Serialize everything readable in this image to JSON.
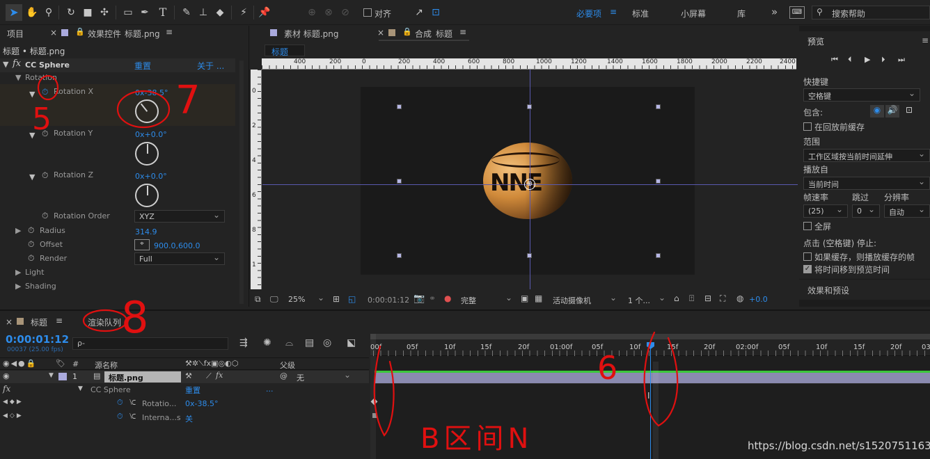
{
  "toolbar": {
    "align_label": "对齐",
    "workspaces": [
      "必要项",
      "标准",
      "小屏幕",
      "库"
    ],
    "more": "»",
    "search_placeholder": "搜索帮助"
  },
  "left_panel": {
    "tab_project": "项目",
    "tab_effect_controls_prefix": "效果控件",
    "tab_effect_controls_layer": "标题.png",
    "breadcrumb": "标题 • 标题.png",
    "effect_name": "CC Sphere",
    "reset_label": "重置",
    "about_label": "关于 ...",
    "group_rotation": "Rotation",
    "rotation_x_label": "Rotation X",
    "rotation_x_value": "0x-38.5°",
    "rotation_y_label": "Rotation Y",
    "rotation_y_value": "0x+0.0°",
    "rotation_z_label": "Rotation Z",
    "rotation_z_value": "0x+0.0°",
    "rotation_order_label": "Rotation Order",
    "rotation_order_value": "XYZ",
    "radius_label": "Radius",
    "radius_value": "314.9",
    "offset_label": "Offset",
    "offset_value": "900.0,600.0",
    "render_label": "Render",
    "render_value": "Full",
    "light_label": "Light",
    "shading_label": "Shading"
  },
  "viewer": {
    "tab_footage": "素材 标题.png",
    "tab_composition_prefix": "合成",
    "tab_composition_name": "标题",
    "comp_chip": "标题",
    "ruler_labels": [
      "400",
      "200",
      "0",
      "200",
      "400",
      "600",
      "800",
      "1000",
      "1200",
      "1400",
      "1600",
      "1800",
      "2000",
      "2200",
      "2400"
    ],
    "vruler_labels": [
      "0",
      "2",
      "4",
      "6",
      "8",
      "1"
    ],
    "zoom": "25%",
    "timecode": "0:00:01:12",
    "quality": "完整",
    "camera": "活动摄像机",
    "views": "1 个...",
    "exposure": "+0.0"
  },
  "right_panel": {
    "preview_title": "预览",
    "shortcut_label": "快捷键",
    "shortcut_value": "空格键",
    "include_label": "包含:",
    "cache_before_label": "在回放前缓存",
    "range_label": "范围",
    "range_value": "工作区域按当前时间延伸",
    "play_from_label": "播放自",
    "play_from_value": "当前时间",
    "frame_rate_label": "帧速率",
    "skip_label": "跳过",
    "resolution_label": "分辨率",
    "frame_rate_value": "(25)",
    "skip_value": "0",
    "resolution_value": "自动",
    "fullscreen_label": "全屏",
    "stop_label": "点击 (空格键) 停止:",
    "cached_label": "如果缓存，则播放缓存的帧",
    "move_time_label": "将时间移到预览时间",
    "effects_presets": "效果和预设"
  },
  "timeline": {
    "tab_comp": "标题",
    "tab_render_queue": "渲染队列",
    "timecode": "0:00:01:12",
    "frame_info": "00037 (25.00 fps)",
    "search_placeholder": "ρ-",
    "col_index": "#",
    "col_source": "源名称",
    "col_parent": "父级",
    "layer_index": "1",
    "layer_name": "标题.png",
    "layer_parent": "无",
    "fx_label": "fx",
    "effect_name": "CC Sphere",
    "effect_reset": "重置",
    "effect_dots": "...",
    "prop1_label": "Rotatio...",
    "prop1_value": "0x-38.5°",
    "prop2_label": "Interna...s",
    "prop2_value": "关",
    "ruler_labels": [
      "00f",
      "05f",
      "10f",
      "15f",
      "20f",
      "01:00f",
      "05f",
      "10f",
      "15f",
      "20f",
      "02:00f",
      "05f",
      "10f",
      "15f",
      "20f",
      "03"
    ]
  },
  "annotations": [
    "5",
    "7",
    "8",
    "6",
    "B区间N"
  ],
  "watermark": "https://blog.csdn.net/s15207511639"
}
